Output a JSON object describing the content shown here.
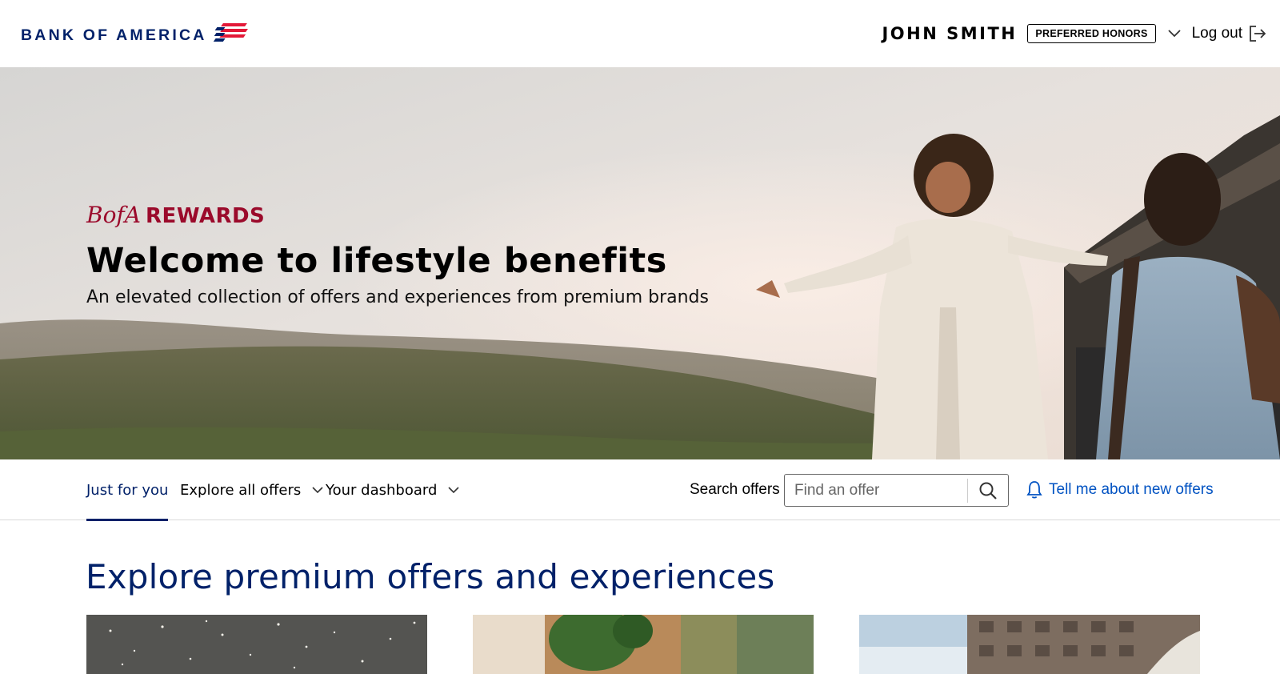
{
  "header": {
    "logo_text": "BANK OF AMERICA",
    "user_name": "JOHN SMITH",
    "tier_badge": "PREFERRED HONORS",
    "logout_label": "Log out",
    "icons": [
      "bofa-flag-logo",
      "chevron-down-icon",
      "logout-icon"
    ]
  },
  "hero": {
    "brand_prefix": "BofA",
    "brand_word": "REWARDS",
    "title": "Welcome to lifestyle benefits",
    "subtitle": "An elevated collection of offers and experiences from premium brands"
  },
  "subnav": {
    "tabs": [
      {
        "label": "Just for you",
        "active": true,
        "has_dropdown": false
      },
      {
        "label": "Explore all offers",
        "active": false,
        "has_dropdown": true
      },
      {
        "label": "Your dashboard",
        "active": false,
        "has_dropdown": true
      }
    ],
    "search_label": "Search offers",
    "search_placeholder": "Find an offer",
    "notify_label": "Tell me about new offers",
    "icons": [
      "search-icon",
      "bell-icon"
    ]
  },
  "explore": {
    "title": "Explore premium offers and experiences"
  },
  "colors": {
    "navy": "#012169",
    "brand_red": "#9b0a2b",
    "link_blue": "#0052c2"
  }
}
